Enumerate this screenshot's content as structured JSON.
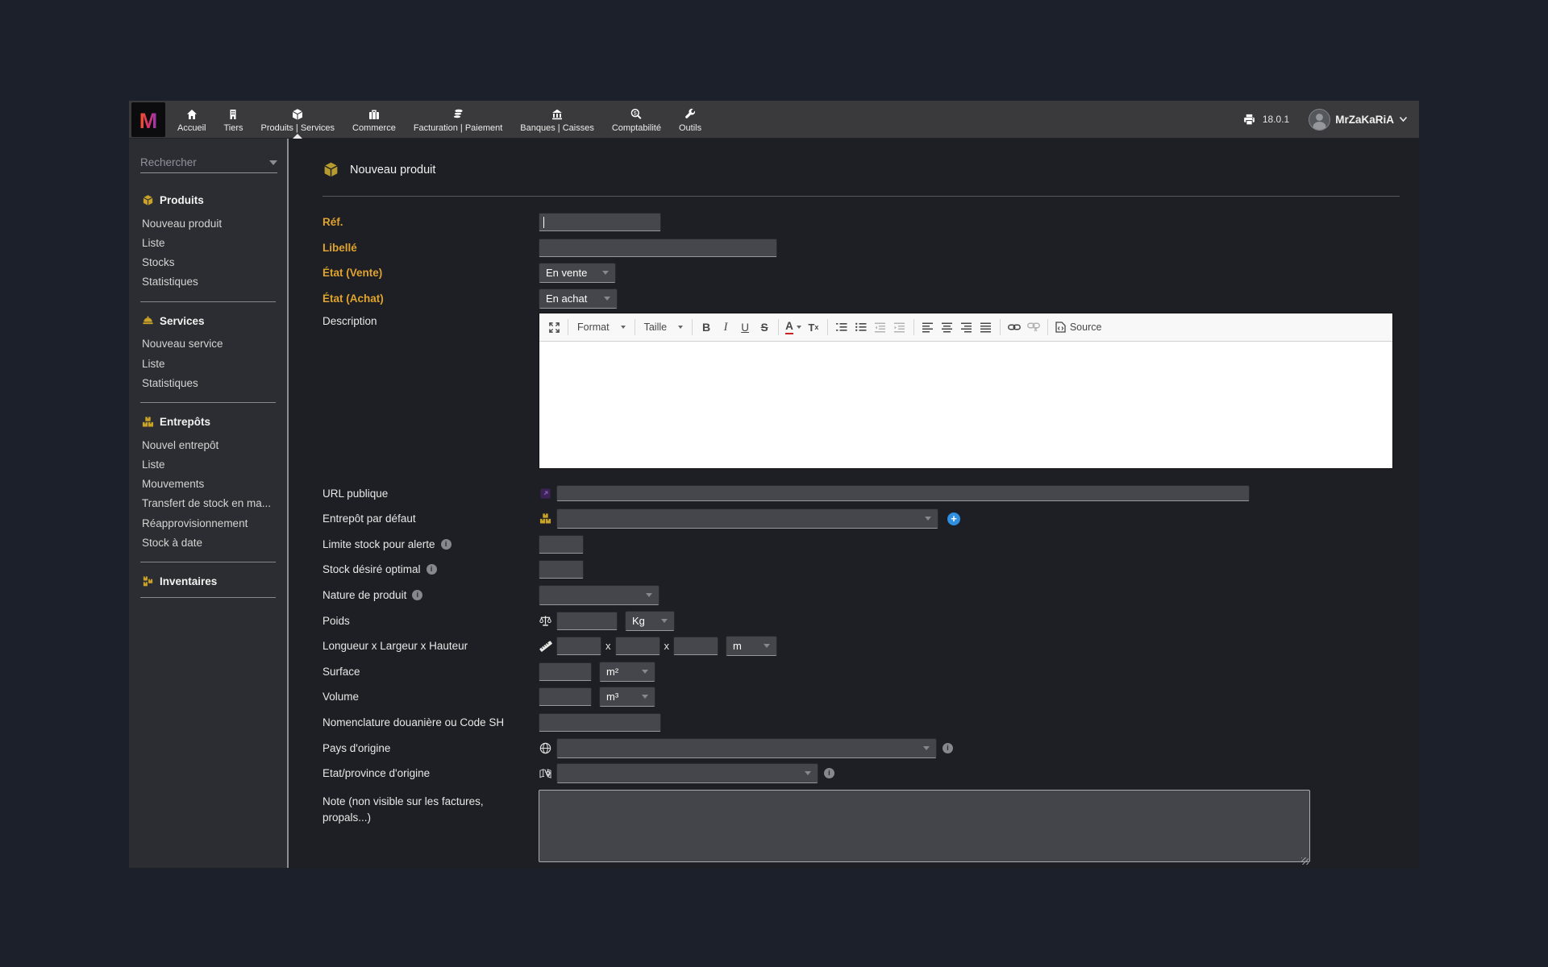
{
  "navbar": {
    "items": [
      {
        "label": "Accueil",
        "icon": "home-icon"
      },
      {
        "label": "Tiers",
        "icon": "building-icon"
      },
      {
        "label": "Produits | Services",
        "icon": "cube-icon",
        "active": true
      },
      {
        "label": "Commerce",
        "icon": "briefcase-icon"
      },
      {
        "label": "Facturation | Paiement",
        "icon": "coins-icon"
      },
      {
        "label": "Banques | Caisses",
        "icon": "bank-icon"
      },
      {
        "label": "Comptabilité",
        "icon": "search-dollar-icon"
      },
      {
        "label": "Outils",
        "icon": "wrench-icon"
      }
    ],
    "version": "18.0.1",
    "user": "MrZaKaRiA"
  },
  "sidebar": {
    "search_placeholder": "Rechercher",
    "sections": [
      {
        "title": "Produits",
        "icon": "cube-icon",
        "items": [
          "Nouveau produit",
          "Liste",
          "Stocks",
          "Statistiques"
        ]
      },
      {
        "title": "Services",
        "icon": "service-dome-icon",
        "items": [
          "Nouveau service",
          "Liste",
          "Statistiques"
        ]
      },
      {
        "title": "Entrepôts",
        "icon": "boxes-icon",
        "items": [
          "Nouvel entrepôt",
          "Liste",
          "Mouvements",
          "Transfert de stock en ma...",
          "Réapprovisionnement",
          "Stock à date"
        ]
      },
      {
        "title": "Inventaires",
        "icon": "boxes-stacked-icon",
        "items": []
      }
    ]
  },
  "main": {
    "title": "Nouveau produit",
    "form": {
      "ref": {
        "label": "Réf."
      },
      "libelle": {
        "label": "Libellé"
      },
      "etat_vente": {
        "label": "État (Vente)",
        "value": "En vente"
      },
      "etat_achat": {
        "label": "État (Achat)",
        "value": "En achat"
      },
      "description": {
        "label": "Description"
      },
      "url": {
        "label": "URL publique"
      },
      "entrepot": {
        "label": "Entrepôt par défaut"
      },
      "limite": {
        "label": "Limite stock pour alerte"
      },
      "stock_opt": {
        "label": "Stock désiré optimal"
      },
      "nature": {
        "label": "Nature de produit"
      },
      "poids": {
        "label": "Poids",
        "unit": "Kg"
      },
      "dims": {
        "label": "Longueur x Largeur x Hauteur",
        "sep": "x",
        "unit": "m"
      },
      "surface": {
        "label": "Surface",
        "unit": "m²"
      },
      "volume": {
        "label": "Volume",
        "unit": "m³"
      },
      "nomenclature": {
        "label": "Nomenclature douanière ou Code SH"
      },
      "pays": {
        "label": "Pays d'origine"
      },
      "province": {
        "label": "Etat/province d'origine"
      },
      "note": {
        "label": "Note (non visible sur les factures, propals...)"
      }
    }
  },
  "editor": {
    "format": "Format",
    "taille": "Taille",
    "bold": "B",
    "italic": "I",
    "underline": "U",
    "strike": "S",
    "color": "A",
    "removeformat_t": "T",
    "removeformat_x": "x",
    "source": "Source"
  },
  "colors": {
    "accent_gold": "#c9a227",
    "required_label": "#e0a32e",
    "add_button_blue": "#2f8fe0",
    "navbar_bg": "#3a3a3d",
    "sidebar_bg": "#2b2d32",
    "content_bg": "#1d1f24"
  }
}
